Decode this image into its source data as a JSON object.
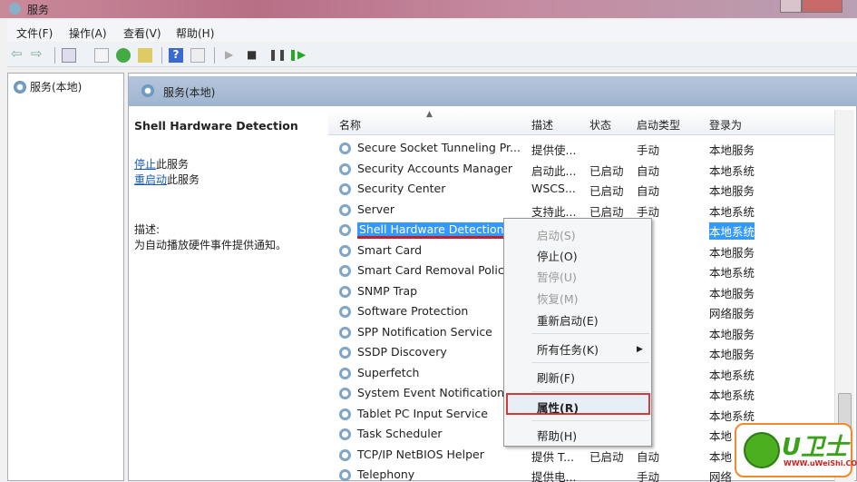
{
  "window": {
    "title": "服务"
  },
  "menu": [
    "文件(F)",
    "操作(A)",
    "查看(V)",
    "帮助(H)"
  ],
  "toolbar": [
    "back-icon",
    "forward-icon",
    "console-tree-icon",
    "properties-icon",
    "refresh-icon",
    "export-icon",
    "help-icon",
    "view-icon",
    "start-icon",
    "stop-icon",
    "pause-icon",
    "restart-icon"
  ],
  "tree": {
    "root": "服务(本地)"
  },
  "header": {
    "title": "服务(本地)"
  },
  "detail": {
    "title": "Shell Hardware Detection",
    "stop_link": "停止",
    "stop_suffix": "此服务",
    "restart_link": "重启动",
    "restart_suffix": "此服务",
    "desc_label": "描述:",
    "desc_text": "为自动播放硬件事件提供通知。"
  },
  "columns": [
    "名称",
    "描述",
    "状态",
    "启动类型",
    "登录为"
  ],
  "rows": [
    {
      "name": "Secure Socket Tunneling Pr...",
      "desc": "提供使...",
      "status": "",
      "startup": "手动",
      "logon": "本地服务"
    },
    {
      "name": "Security Accounts Manager",
      "desc": "启动此...",
      "status": "已启动",
      "startup": "自动",
      "logon": "本地系统"
    },
    {
      "name": "Security Center",
      "desc": "WSCS...",
      "status": "已启动",
      "startup": "自动",
      "logon": "本地服务"
    },
    {
      "name": "Server",
      "desc": "支持此...",
      "status": "已启动",
      "startup": "手动",
      "logon": "本地系统"
    },
    {
      "name": "Shell Hardware Detection",
      "desc": "",
      "status": "",
      "startup": "动",
      "logon": "本地系统",
      "selected": true
    },
    {
      "name": "Smart Card",
      "desc": "",
      "status": "",
      "startup": "动",
      "logon": "本地服务"
    },
    {
      "name": "Smart Card Removal Polic",
      "desc": "",
      "status": "",
      "startup": "用",
      "logon": "本地系统"
    },
    {
      "name": "SNMP Trap",
      "desc": "",
      "status": "",
      "startup": "用",
      "logon": "本地服务"
    },
    {
      "name": "Software Protection",
      "desc": "",
      "status": "",
      "startup": "动",
      "logon": "网络服务"
    },
    {
      "name": "SPP Notification Service",
      "desc": "",
      "status": "",
      "startup": "动",
      "logon": "本地服务"
    },
    {
      "name": "SSDP Discovery",
      "desc": "",
      "status": "",
      "startup": "动",
      "logon": "本地服务"
    },
    {
      "name": "Superfetch",
      "desc": "",
      "status": "",
      "startup": "动",
      "logon": "本地系统"
    },
    {
      "name": "System Event Notification",
      "desc": "",
      "status": "",
      "startup": "动",
      "logon": "本地系统"
    },
    {
      "name": "Tablet PC Input Service",
      "desc": "",
      "status": "",
      "startup": "动",
      "logon": "本地系统"
    },
    {
      "name": "Task Scheduler",
      "desc": "",
      "status": "",
      "startup": "动",
      "logon": "本地"
    },
    {
      "name": "TCP/IP NetBIOS Helper",
      "desc": "提供 T...",
      "status": "已启动",
      "startup": "自动",
      "logon": "本地"
    },
    {
      "name": "Telephony",
      "desc": "提供电...",
      "status": "",
      "startup": "手动",
      "logon": "网络"
    }
  ],
  "context_menu": [
    {
      "label": "启动(S)",
      "disabled": true
    },
    {
      "label": "停止(O)",
      "disabled": false
    },
    {
      "label": "暂停(U)",
      "disabled": true
    },
    {
      "label": "恢复(M)",
      "disabled": true
    },
    {
      "label": "重新启动(E)",
      "disabled": false
    },
    {
      "label": "所有任务(K)",
      "disabled": false,
      "submenu": true
    },
    {
      "label": "刷新(F)",
      "disabled": false
    },
    {
      "label": "属性(R)",
      "disabled": false,
      "highlighted": true
    },
    {
      "label": "帮助(H)",
      "disabled": false
    }
  ],
  "watermark": {
    "brand": "U卫士",
    "url": "WWW.uWeiShi.COM"
  },
  "colors": {
    "selection": "#3399ff",
    "highlight_border": "#d43a3a",
    "header_band": "#a9bdd6"
  }
}
